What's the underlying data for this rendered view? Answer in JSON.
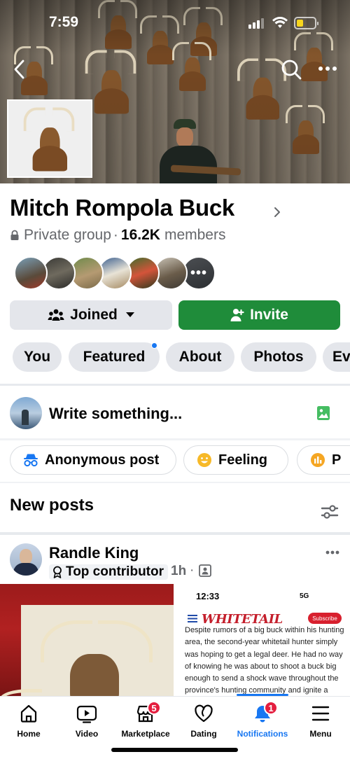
{
  "status_bar": {
    "time": "7:59"
  },
  "group": {
    "name": "Mitch Rompola Buck",
    "privacy": "Private group",
    "separator": "·",
    "member_count": "16.2K",
    "member_label": "members"
  },
  "actions": {
    "joined_label": "Joined",
    "invite_label": "Invite"
  },
  "tabs": [
    {
      "label": "You"
    },
    {
      "label": "Featured"
    },
    {
      "label": "About"
    },
    {
      "label": "Photos"
    },
    {
      "label": "Ev"
    }
  ],
  "composer": {
    "placeholder": "Write something..."
  },
  "chips": [
    {
      "label": "Anonymous post",
      "icon": "incognito-icon"
    },
    {
      "label": "Feeling",
      "icon": "smiley-icon"
    },
    {
      "label": "P",
      "icon": "poll-icon"
    }
  ],
  "feed": {
    "section_title": "New posts"
  },
  "post": {
    "author": "Randle King",
    "badge": "Top contributor",
    "time": "1h",
    "separator": "·",
    "embed": {
      "time": "12:33",
      "status": "5G",
      "logo": "WHITETAIL",
      "subscribe": "Subscribe",
      "text": "Despite rumors of a big buck within his hunting area, the second-year whitetail hunter simply was hoping to get a legal deer. He had no way of knowing he was about to shoot a buck big enough to send a shock wave throughout the province's hunting community and ignite a social media"
    }
  },
  "bottom_nav": [
    {
      "label": "Home",
      "icon": "home-icon",
      "active": false
    },
    {
      "label": "Video",
      "icon": "video-icon",
      "active": false
    },
    {
      "label": "Marketplace",
      "icon": "marketplace-icon",
      "active": false,
      "badge": "5"
    },
    {
      "label": "Dating",
      "icon": "dating-icon",
      "active": false
    },
    {
      "label": "Notifications",
      "icon": "bell-icon",
      "active": true,
      "badge": "1"
    },
    {
      "label": "Menu",
      "icon": "menu-icon",
      "active": false
    }
  ],
  "colors": {
    "accent_blue": "#1877f2",
    "invite_green": "#1f8c3a",
    "badge_red": "#e41e3f",
    "secondary_text": "#65676b",
    "chip_bg": "#e4e6eb"
  }
}
